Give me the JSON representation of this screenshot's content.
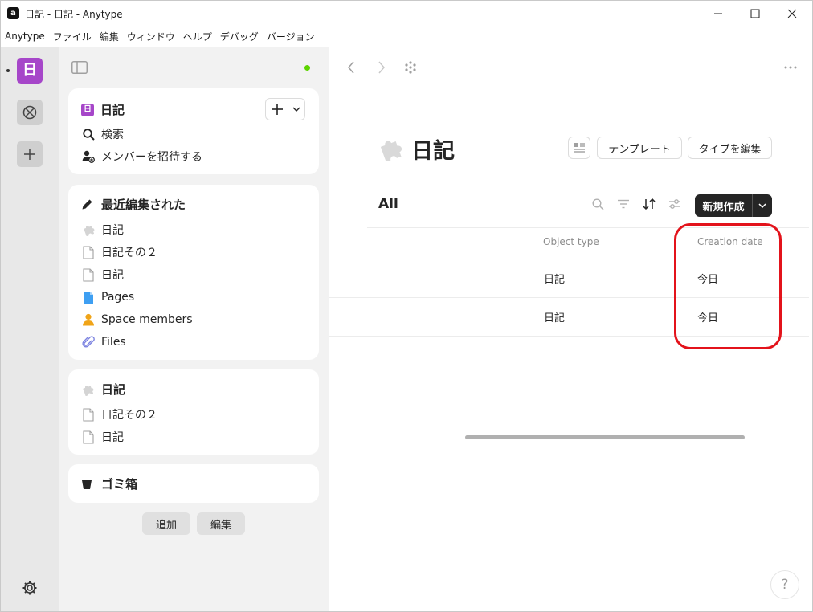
{
  "window": {
    "title": "日記 - 日記 - Anytype",
    "app_icon_glyph": "a"
  },
  "menu": [
    "Anytype",
    "ファイル",
    "編集",
    "ウィンドウ",
    "ヘルプ",
    "デバッグ",
    "バージョン"
  ],
  "rail": {
    "space_letter": "日",
    "space_color": "#a646c9"
  },
  "sidebar": {
    "space_card": {
      "badge": "日",
      "title": "日記",
      "items": [
        {
          "label": "検索",
          "icon": "search-icon"
        },
        {
          "label": "メンバーを招待する",
          "icon": "invite-member-icon"
        }
      ]
    },
    "recent_card": {
      "title": "最近編集された",
      "items": [
        {
          "label": "日記",
          "icon": "puzzle-icon"
        },
        {
          "label": "日記その２",
          "icon": "page-icon"
        },
        {
          "label": "日記",
          "icon": "page-icon"
        },
        {
          "label": "Pages",
          "icon": "pages-icon"
        },
        {
          "label": "Space members",
          "icon": "person-icon"
        },
        {
          "label": "Files",
          "icon": "paperclip-icon"
        }
      ]
    },
    "type_card": {
      "title": "日記",
      "items": [
        {
          "label": "日記その２",
          "icon": "page-icon"
        },
        {
          "label": "日記",
          "icon": "page-icon"
        }
      ]
    },
    "bin_card": {
      "title": "ゴミ箱"
    },
    "add_label": "追加",
    "edit_label": "編集"
  },
  "main": {
    "title": "日記",
    "template_label": "テンプレート",
    "edit_type_label": "タイプを編集",
    "view_name": "All",
    "new_label": "新規作成",
    "columns": [
      "Object type",
      "Creation date"
    ],
    "rows": [
      {
        "type": "日記",
        "created": "今日"
      },
      {
        "type": "日記",
        "created": "今日"
      }
    ],
    "help_label": "?"
  },
  "colors": {
    "accent_purple": "#a646c9",
    "online_green": "#5dd400",
    "annotation_red": "#e3131b"
  }
}
